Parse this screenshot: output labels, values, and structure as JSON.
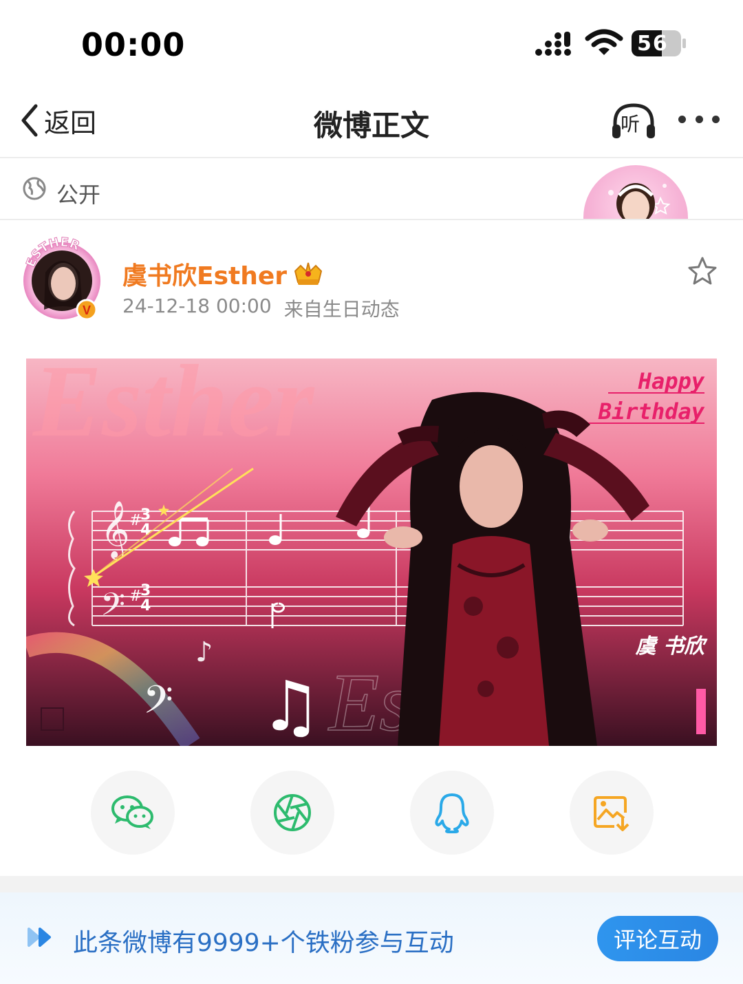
{
  "status_bar": {
    "time": "00:00",
    "battery": "56"
  },
  "nav": {
    "back_label": "返回",
    "title": "微博正文",
    "listen_label": "听"
  },
  "visibility": {
    "label": "公开"
  },
  "post": {
    "author": "虞书欣Esther",
    "avatar_ring_text": "ESTHER",
    "date": "24-12-18 00:00",
    "source": "来自生日动态",
    "image_text": {
      "big_name": "Esther",
      "happy": "Happy",
      "birthday": "Birthday",
      "signature": "虞 书欣",
      "watermark": "Esther"
    }
  },
  "share": {
    "items": [
      "wechat-icon",
      "moments-icon",
      "qq-icon",
      "save-image-icon"
    ]
  },
  "bottom": {
    "fans_text": "此条微博有9999+个铁粉参与互动",
    "comment_button": "评论互动"
  },
  "colors": {
    "author": "#f07a20",
    "fans_text": "#2a6fc4",
    "comment_button": "#2f95ee",
    "wechat": "#2dbb6e",
    "qq": "#2aa9e8",
    "save": "#f5a623"
  }
}
